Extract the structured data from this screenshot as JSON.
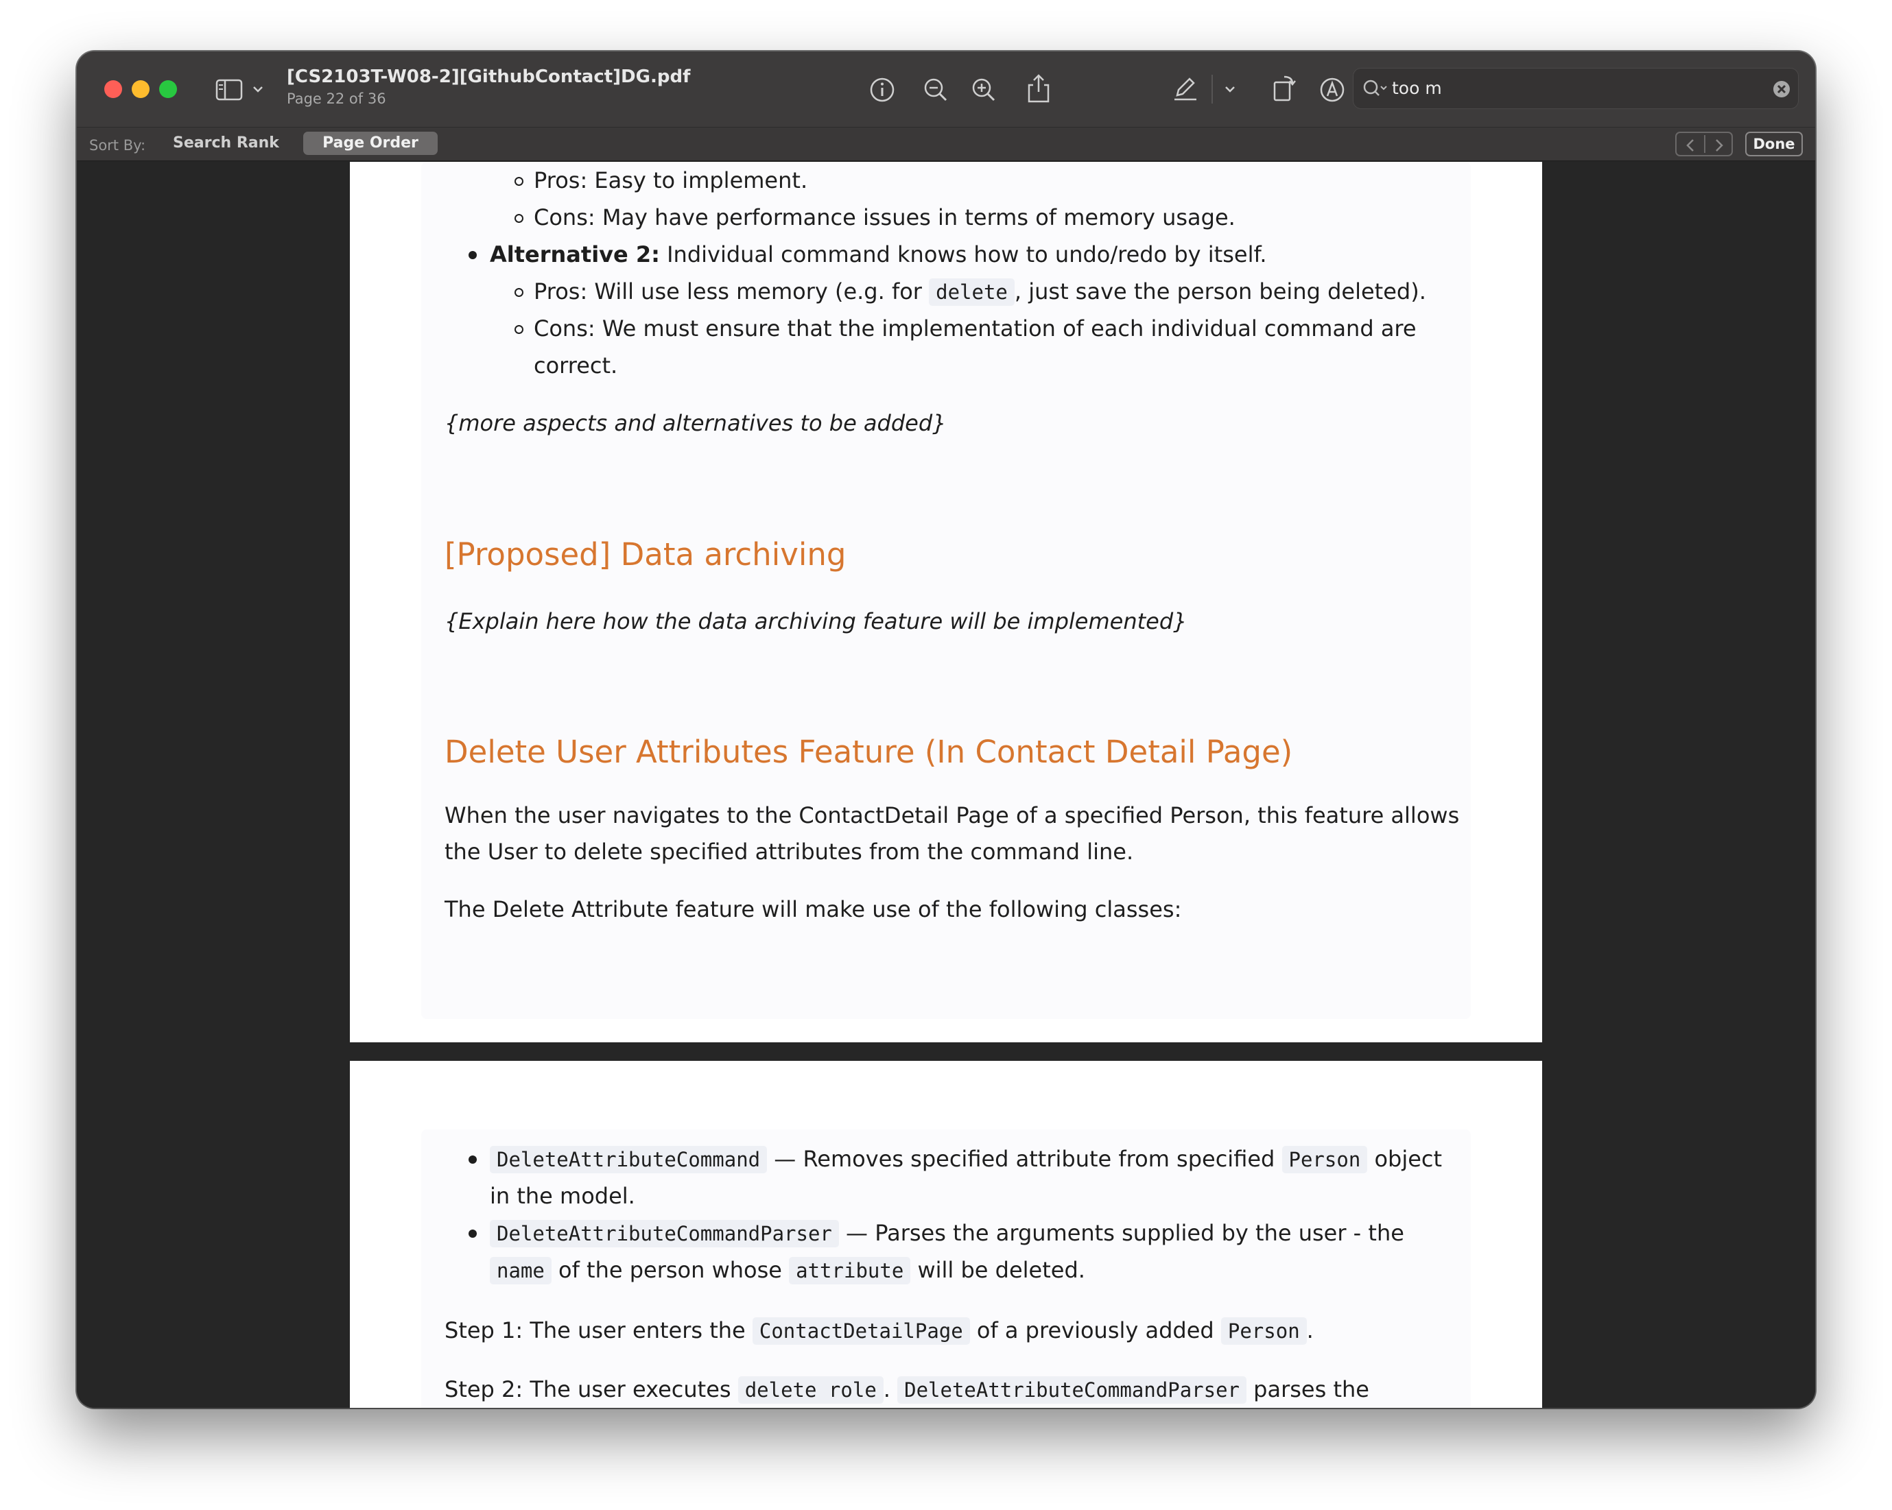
{
  "window": {
    "title": "[CS2103T-W08-2][GithubContact]DG.pdf",
    "subtitle": "Page 22 of 36"
  },
  "search": {
    "value": "too m"
  },
  "sortbar": {
    "label": "Sort By:",
    "search_rank": "Search Rank",
    "page_order": "Page Order",
    "done": "Done"
  },
  "page1": {
    "l1": "Pros: Easy to implement.",
    "l2": "Cons: May have performance issues in terms of memory usage.",
    "l3_bold": "Alternative 2:",
    "l3_rest": " Individual command knows how to undo/redo by itself.",
    "l4_a": "Pros: Will use less memory (e.g. for ",
    "l4_code": "delete",
    "l4_b": ", just save the person being deleted).",
    "l5": "Cons: We must ensure that the implementation of each individual command are",
    "l6": "correct.",
    "more_aspects": "{more aspects and alternatives to be added}",
    "h_archiving": "[Proposed] Data archiving",
    "archiving_note": "{Explain here how the data archiving feature will be implemented}",
    "h_delete": "Delete User Attributes Feature (In Contact Detail Page)",
    "p1a": "When the user navigates to the ContactDetail Page of a specified Person, this feature allows",
    "p1b": "the User to delete specified attributes from the command line.",
    "p2": "The Delete Attribute feature will make use of the following classes:"
  },
  "page2": {
    "b1_code": "DeleteAttributeCommand",
    "b1_text": " — Removes specified attribute from specified ",
    "b1_code2": "Person",
    "b1_text2": " object",
    "b1_line2": "in the model.",
    "b2_code": "DeleteAttributeCommandParser",
    "b2_text": " — Parses the arguments supplied by the user - the",
    "b2_code2": "name",
    "b2_text2": " of the person whose ",
    "b2_code3": "attribute",
    "b2_text3": " will be deleted.",
    "s1_a": "Step 1: The user enters the ",
    "s1_code": "ContactDetailPage",
    "s1_b": " of a previously added ",
    "s1_code2": "Person",
    "s1_c": ".",
    "s2_a": "Step 2: The user executes ",
    "s2_code": "delete role",
    "s2_b": ". ",
    "s2_code2": "DeleteAttributeCommandParser",
    "s2_c": " parses the"
  }
}
